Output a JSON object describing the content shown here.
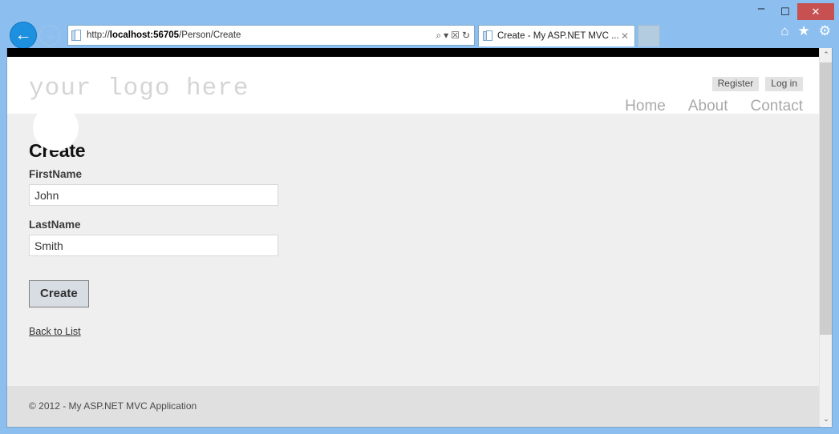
{
  "window": {
    "minimize_label": "–",
    "maximize_label": "☐",
    "close_label": "✕",
    "title_bar_color": "#8cbff0"
  },
  "browser": {
    "back_label": "←",
    "forward_label": "→",
    "address": {
      "url_scheme": "http://",
      "url_host": "localhost:56705",
      "url_path": "/Person/Create",
      "full_url": "http://localhost:56705/Person/Create",
      "search_icon": "search-icon",
      "dropdown_icon": "chevron-down-icon",
      "compat_icon": "compatibility-view-icon",
      "refresh_icon": "refresh-icon",
      "search_glyph": "⌕",
      "dropdown_glyph": "▾",
      "compat_glyph": "☒",
      "refresh_glyph": "↻"
    },
    "tab": {
      "title": "Create - My ASP.NET MVC ...",
      "close_glyph": "✕"
    },
    "commands": [
      {
        "name": "home-icon",
        "glyph": "⌂"
      },
      {
        "name": "favorites-icon",
        "glyph": "★"
      },
      {
        "name": "settings-icon",
        "glyph": "⚙"
      }
    ]
  },
  "site": {
    "logo_text": "your logo here",
    "auth_buttons": [
      {
        "label": "Register"
      },
      {
        "label": "Log in"
      }
    ],
    "nav": [
      {
        "label": "Home"
      },
      {
        "label": "About"
      },
      {
        "label": "Contact"
      }
    ],
    "footer": "© 2012 - My ASP.NET MVC Application"
  },
  "form": {
    "title": "Create",
    "fields": [
      {
        "label": "FirstName",
        "value": "John"
      },
      {
        "label": "LastName",
        "value": "Smith"
      }
    ],
    "submit_label": "Create",
    "back_link_label": "Back to List"
  },
  "scrollbar": {
    "up_glyph": "⌃",
    "down_glyph": "⌄"
  }
}
